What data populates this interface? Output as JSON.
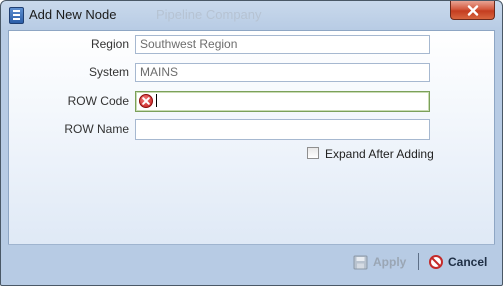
{
  "window": {
    "title": "Add New Node",
    "ghost_title": "Pipeline Company"
  },
  "form": {
    "region": {
      "label": "Region",
      "value": "Southwest Region"
    },
    "system": {
      "label": "System",
      "value": "MAINS"
    },
    "row_code": {
      "label": "ROW Code",
      "value": ""
    },
    "row_name": {
      "label": "ROW Name",
      "value": ""
    },
    "expand_after_adding": {
      "label": "Expand After Adding",
      "checked": false
    }
  },
  "footer": {
    "apply_label": "Apply",
    "cancel_label": "Cancel"
  },
  "icons": {
    "app": "app-list-icon",
    "close": "close-icon",
    "error": "error-icon",
    "apply": "save-icon",
    "cancel": "cancel-icon"
  },
  "colors": {
    "close_button": "#c43d20",
    "error": "#c41818",
    "active_border": "#7ba05a"
  }
}
